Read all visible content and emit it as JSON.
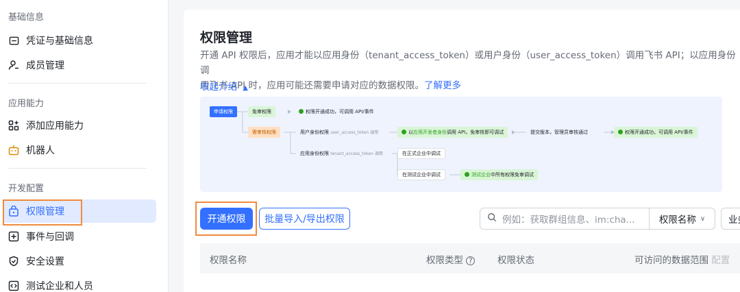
{
  "sidebar": {
    "group_basic": "基础信息",
    "items_basic": [
      {
        "label": "凭证与基础信息",
        "icon": "credential-icon"
      },
      {
        "label": "成员管理",
        "icon": "add-user-icon"
      }
    ],
    "group_ability": "应用能力",
    "items_ability": [
      {
        "label": "添加应用能力",
        "icon": "apps-grid-icon"
      },
      {
        "label": "机器人",
        "icon": "robot-icon"
      }
    ],
    "group_dev": "开发配置",
    "items_dev": [
      {
        "label": "权限管理",
        "icon": "lock-icon",
        "active": true
      },
      {
        "label": "事件与回调",
        "icon": "event-icon"
      },
      {
        "label": "安全设置",
        "icon": "shield-icon"
      },
      {
        "label": "测试企业和人员",
        "icon": "code-icon"
      }
    ]
  },
  "page": {
    "title": "权限管理",
    "desc_line1": "开通 API 权限后，应用才能以应用身份（tenant_access_token）或用户身份（user_access_token）调用飞书 API；以应用身份调",
    "desc_line2": "用飞书 API 时，应用可能还需要申请对应的数据权限。",
    "desc_link": "了解更多",
    "collapse_label": "收起介绍"
  },
  "flow": {
    "apply": "申请权限",
    "free": "免审权限",
    "free_result": "权限开通成功，可调用 API/事件",
    "need_review": "需审核权限",
    "user_identity": "用户身份权限",
    "user_identity_tok": "user_access_token 调用",
    "user_dev_result_a": "以",
    "user_dev_result_b": "应用开发者身份",
    "user_dev_result_c": "调用 API，免审核即可调试",
    "submit": "提交版本，管理员审核通过",
    "final_result": "权限开通成功，可调用 API/事件",
    "app_identity": "应用身份权限",
    "app_identity_tok": "tenant_access_token 调用",
    "formal_debug": "在正式企业中调试",
    "test_debug": "在测试企业中调试",
    "test_result_a": "测试企业",
    "test_result_b": "中所有权限免审调试"
  },
  "toolbar": {
    "primary": "开通权限",
    "secondary": "批量导入/导出权限",
    "search_placeholder": "例如：获取群组信息、im:cha...",
    "select_label": "权限名称",
    "select2_label": "业务"
  },
  "table": {
    "col_name": "权限名称",
    "col_type": "权限类型",
    "col_status": "权限状态",
    "col_scope": "可访问的数据范围",
    "col_scope_extra": "配置"
  },
  "colors": {
    "accent": "#3370ff",
    "highlight": "#f08a3e",
    "success": "#2ea121"
  }
}
